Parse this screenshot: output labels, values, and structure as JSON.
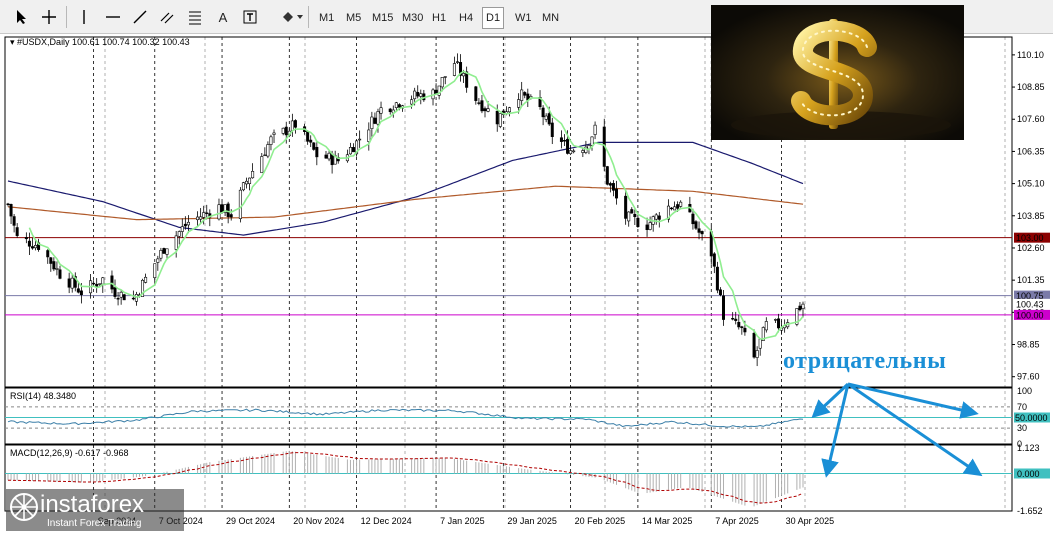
{
  "toolbar": {
    "tools": [
      {
        "id": "cursor",
        "icon": "cursor-arrow-icon"
      },
      {
        "id": "crosshair",
        "icon": "crosshair-icon"
      },
      {
        "id": "vline",
        "icon": "vertical-line-icon"
      },
      {
        "id": "hline",
        "icon": "horizontal-line-icon"
      },
      {
        "id": "trendline",
        "icon": "trendline-icon"
      },
      {
        "id": "channel",
        "icon": "channel-icon"
      },
      {
        "id": "text",
        "label": "A",
        "icon": "text-icon"
      },
      {
        "id": "label",
        "icon": "text-label-icon"
      },
      {
        "id": "shapes",
        "icon": "shapes-icon"
      }
    ],
    "timeframes": [
      "M1",
      "M5",
      "M15",
      "M30",
      "H1",
      "H4",
      "D1",
      "W1",
      "MN"
    ],
    "active_timeframe": "D1"
  },
  "chart": {
    "symbol_line": "#USDX,Daily  100.61 100.74 100.32 100.43",
    "price_scale": [
      "110.10",
      "108.85",
      "107.60",
      "106.35",
      "105.10",
      "103.85",
      "102.60",
      "101.35",
      "100.10",
      "98.85",
      "97.60"
    ],
    "date_labels": [
      "Sep 2024",
      "7 Oct 2024",
      "29 Oct 2024",
      "20 Nov 2024",
      "12 Dec 2024",
      "7 Jan 2025",
      "29 Jan 2025",
      "20 Feb 2025",
      "14 Mar 2025",
      "7 Apr 2025",
      "30 Apr 2025"
    ],
    "levels": [
      {
        "label": "103.00",
        "color": "#8b0000"
      },
      {
        "label": "100.75",
        "color": "#7a7aa8"
      },
      {
        "label": "100.43",
        "color": "#000000"
      },
      {
        "label": "100.00",
        "color": "#cc00cc"
      }
    ],
    "colors": {
      "up": "#000000",
      "fast_ma": "#90ee90",
      "ma_200": "#1a1a6e",
      "ma_brown": "#b05a2a",
      "rsi_line": "#3b7fa8",
      "rsi_level": "#40c0c0",
      "macd_hist": "#b0b0b0",
      "macd_signal": "#b00000",
      "annotation": "#1a8fd6"
    }
  },
  "rsi": {
    "label": "RSI(14) 48.3480",
    "scale": [
      "100",
      "70",
      "30",
      "0"
    ],
    "level_label": "50.0000"
  },
  "macd": {
    "label": "MACD(12,26,9) -0.617 -0.968",
    "scale": [
      "1.123",
      "0.000",
      "-1.652"
    ]
  },
  "annotation": {
    "text": "отрицательны"
  },
  "logo": {
    "name": "instaforex",
    "tagline": "Instant Forex Trading"
  },
  "inset": {
    "icon": "dollar-sign-icon"
  },
  "chart_data": {
    "type": "candlestick",
    "title": "",
    "xlabel": "",
    "ylabel": "",
    "ylim": [
      97.2,
      110.6
    ],
    "y_ticks": [
      110.1,
      108.85,
      107.6,
      106.35,
      105.1,
      103.85,
      102.6,
      101.35,
      100.1,
      98.85,
      97.6
    ],
    "x_range": [
      "2024-08-20",
      "2025-05-07"
    ],
    "x_ticks": [
      "2024-09-17",
      "2024-10-07",
      "2024-10-29",
      "2024-11-20",
      "2024-12-12",
      "2025-01-07",
      "2025-01-29",
      "2025-02-20",
      "2025-03-14",
      "2025-04-07",
      "2025-04-30"
    ],
    "close_anchors": [
      {
        "d": "2024-08-20",
        "v": 104.3
      },
      {
        "d": "2024-08-23",
        "v": 103.0
      },
      {
        "d": "2024-08-30",
        "v": 102.7
      },
      {
        "d": "2024-09-06",
        "v": 101.6
      },
      {
        "d": "2024-09-13",
        "v": 100.9
      },
      {
        "d": "2024-09-20",
        "v": 101.4
      },
      {
        "d": "2024-09-24",
        "v": 100.9
      },
      {
        "d": "2024-09-30",
        "v": 100.6
      },
      {
        "d": "2024-10-03",
        "v": 101.2
      },
      {
        "d": "2024-10-10",
        "v": 102.6
      },
      {
        "d": "2024-10-18",
        "v": 103.6
      },
      {
        "d": "2024-10-28",
        "v": 104.2
      },
      {
        "d": "2024-11-01",
        "v": 103.9
      },
      {
        "d": "2024-11-06",
        "v": 105.2
      },
      {
        "d": "2024-11-14",
        "v": 106.8
      },
      {
        "d": "2024-11-22",
        "v": 107.4
      },
      {
        "d": "2024-11-29",
        "v": 106.2
      },
      {
        "d": "2024-12-06",
        "v": 106.0
      },
      {
        "d": "2024-12-12",
        "v": 106.7
      },
      {
        "d": "2024-12-20",
        "v": 108.0
      },
      {
        "d": "2024-12-31",
        "v": 108.5
      },
      {
        "d": "2025-01-06",
        "v": 108.6
      },
      {
        "d": "2025-01-13",
        "v": 109.8
      },
      {
        "d": "2025-01-20",
        "v": 108.4
      },
      {
        "d": "2025-01-27",
        "v": 107.6
      },
      {
        "d": "2025-02-03",
        "v": 108.6
      },
      {
        "d": "2025-02-10",
        "v": 108.0
      },
      {
        "d": "2025-02-14",
        "v": 107.0
      },
      {
        "d": "2025-02-20",
        "v": 106.4
      },
      {
        "d": "2025-02-25",
        "v": 106.6
      },
      {
        "d": "2025-02-28",
        "v": 107.2
      },
      {
        "d": "2025-03-04",
        "v": 105.2
      },
      {
        "d": "2025-03-10",
        "v": 103.8
      },
      {
        "d": "2025-03-17",
        "v": 103.5
      },
      {
        "d": "2025-03-24",
        "v": 104.2
      },
      {
        "d": "2025-03-28",
        "v": 104.3
      },
      {
        "d": "2025-04-02",
        "v": 103.4
      },
      {
        "d": "2025-04-07",
        "v": 102.4
      },
      {
        "d": "2025-04-11",
        "v": 100.0
      },
      {
        "d": "2025-04-17",
        "v": 99.4
      },
      {
        "d": "2025-04-21",
        "v": 98.3
      },
      {
        "d": "2025-04-25",
        "v": 99.6
      },
      {
        "d": "2025-04-30",
        "v": 99.6
      },
      {
        "d": "2025-05-07",
        "v": 100.43
      }
    ],
    "ma_200_anchors": [
      {
        "d": "2024-08-20",
        "v": 105.2
      },
      {
        "d": "2024-09-20",
        "v": 104.4
      },
      {
        "d": "2024-10-15",
        "v": 103.4
      },
      {
        "d": "2024-11-05",
        "v": 103.1
      },
      {
        "d": "2024-12-01",
        "v": 103.6
      },
      {
        "d": "2025-01-01",
        "v": 104.6
      },
      {
        "d": "2025-02-01",
        "v": 106.0
      },
      {
        "d": "2025-03-01",
        "v": 106.7
      },
      {
        "d": "2025-04-01",
        "v": 106.7
      },
      {
        "d": "2025-04-20",
        "v": 105.9
      },
      {
        "d": "2025-05-07",
        "v": 105.1
      }
    ],
    "ma_brown_anchors": [
      {
        "d": "2024-08-20",
        "v": 104.2
      },
      {
        "d": "2024-10-01",
        "v": 103.7
      },
      {
        "d": "2024-11-15",
        "v": 103.8
      },
      {
        "d": "2025-01-01",
        "v": 104.5
      },
      {
        "d": "2025-02-15",
        "v": 105.0
      },
      {
        "d": "2025-04-01",
        "v": 104.8
      },
      {
        "d": "2025-05-07",
        "v": 104.3
      }
    ],
    "rsi": {
      "ylim": [
        0,
        100
      ],
      "levels": [
        70,
        50,
        30
      ],
      "last": 48.348,
      "anchors": [
        {
          "d": "2024-08-20",
          "v": 42
        },
        {
          "d": "2024-09-10",
          "v": 38
        },
        {
          "d": "2024-10-01",
          "v": 45
        },
        {
          "d": "2024-10-20",
          "v": 62
        },
        {
          "d": "2024-11-10",
          "v": 64
        },
        {
          "d": "2024-12-01",
          "v": 56
        },
        {
          "d": "2024-12-20",
          "v": 64
        },
        {
          "d": "2025-01-13",
          "v": 63
        },
        {
          "d": "2025-02-05",
          "v": 48
        },
        {
          "d": "2025-02-25",
          "v": 47
        },
        {
          "d": "2025-03-10",
          "v": 33
        },
        {
          "d": "2025-03-25",
          "v": 42
        },
        {
          "d": "2025-04-10",
          "v": 34
        },
        {
          "d": "2025-04-22",
          "v": 32
        },
        {
          "d": "2025-05-07",
          "v": 48.3
        }
      ]
    },
    "macd": {
      "ylim": [
        -1.652,
        1.123
      ],
      "main": -0.617,
      "signal": -0.968,
      "hist_anchors": [
        {
          "d": "2024-08-20",
          "v": -0.3
        },
        {
          "d": "2024-09-15",
          "v": -0.4
        },
        {
          "d": "2024-10-05",
          "v": -0.1
        },
        {
          "d": "2024-10-25",
          "v": 0.5
        },
        {
          "d": "2024-11-20",
          "v": 1.0
        },
        {
          "d": "2024-12-10",
          "v": 0.6
        },
        {
          "d": "2025-01-10",
          "v": 0.7
        },
        {
          "d": "2025-02-05",
          "v": 0.2
        },
        {
          "d": "2025-03-01",
          "v": -0.2
        },
        {
          "d": "2025-03-15",
          "v": -0.9
        },
        {
          "d": "2025-03-30",
          "v": -0.6
        },
        {
          "d": "2025-04-20",
          "v": -1.5
        },
        {
          "d": "2025-05-07",
          "v": -0.617
        }
      ]
    }
  }
}
